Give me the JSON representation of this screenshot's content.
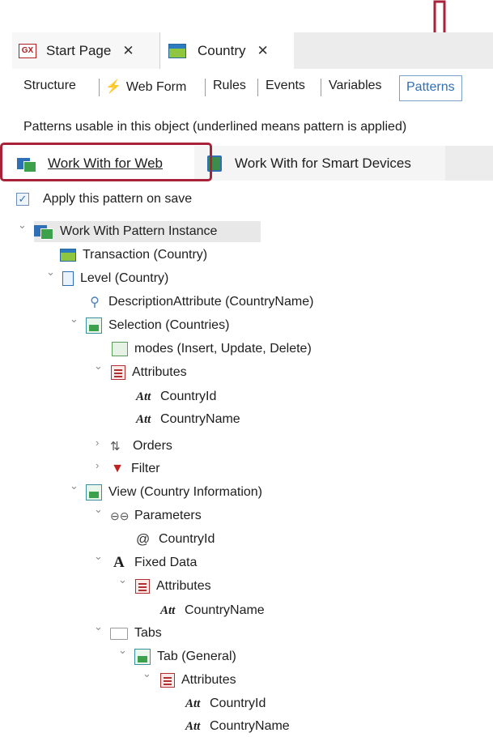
{
  "doc_tabs": [
    {
      "label": "Start Page",
      "icon": "gx-icon",
      "close": "✕"
    },
    {
      "label": "Country",
      "icon": "transaction-icon",
      "close": "✕"
    }
  ],
  "sub_tabs": [
    "Structure",
    "Web Form",
    "Rules",
    "Events",
    "Variables",
    "Patterns"
  ],
  "active_sub_tab": "Patterns",
  "hint": "Patterns usable in this object (underlined means pattern is applied)",
  "pattern_tabs": [
    "Work With for Web",
    "Work With for Smart Devices"
  ],
  "apply_checkbox": {
    "checked": true,
    "label": "Apply this pattern on save"
  },
  "tree": [
    {
      "label": "Work With Pattern Instance",
      "icon": "work-with-icon",
      "expanded": true,
      "selected": true
    },
    {
      "label": "Transaction (Country)",
      "icon": "transaction-icon"
    },
    {
      "label": "Level (Country)",
      "icon": "level-icon",
      "expanded": true
    },
    {
      "label": "DescriptionAttribute (CountryName)",
      "icon": "description-icon"
    },
    {
      "label": "Selection (Countries)",
      "icon": "selection-icon",
      "expanded": true
    },
    {
      "label": "modes (Insert, Update, Delete)",
      "icon": "modes-icon"
    },
    {
      "label": "Attributes",
      "icon": "attributes-icon",
      "expanded": true
    },
    {
      "label": "CountryId",
      "icon": "att-icon"
    },
    {
      "label": "CountryName",
      "icon": "att-icon"
    },
    {
      "label": "Orders",
      "icon": "orders-icon",
      "expanded": false
    },
    {
      "label": "Filter",
      "icon": "filter-icon",
      "expanded": false
    },
    {
      "label": "View (Country Information)",
      "icon": "view-icon",
      "expanded": true
    },
    {
      "label": "Parameters",
      "icon": "parameters-icon",
      "expanded": true
    },
    {
      "label": "CountryId",
      "icon": "at-icon"
    },
    {
      "label": "Fixed Data",
      "icon": "fixed-data-icon",
      "expanded": true
    },
    {
      "label": "Attributes",
      "icon": "attributes-icon",
      "expanded": true
    },
    {
      "label": "CountryName",
      "icon": "att-icon"
    },
    {
      "label": "Tabs",
      "icon": "folder-icon",
      "expanded": true
    },
    {
      "label": "Tab (General)",
      "icon": "tab-icon",
      "expanded": true
    },
    {
      "label": "Attributes",
      "icon": "attributes-icon",
      "expanded": true
    },
    {
      "label": "CountryId",
      "icon": "att-icon"
    },
    {
      "label": "CountryName",
      "icon": "att-icon"
    }
  ],
  "glyphs": {
    "att": "Att",
    "at": "@",
    "fixed": "A",
    "expand_open": "⌄",
    "expand_closed": "›",
    "check": "✓"
  },
  "colors": {
    "highlight": "#a8223a",
    "active_tab_text": "#2e6fb5",
    "tab_strip": "#ececec"
  }
}
